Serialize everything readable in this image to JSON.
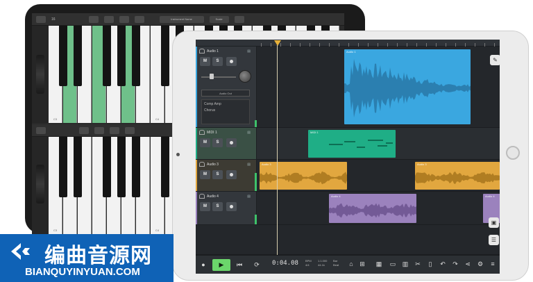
{
  "back_ipad": {
    "toolbar": {
      "left_label": "16",
      "octave_label": "C3",
      "preset_label": "Instrument Name",
      "mode_label": "Scale"
    },
    "keyboard_labels": [
      "C3",
      "C4",
      "C5"
    ]
  },
  "daw": {
    "tracks": [
      {
        "name": "Audio 1",
        "buttons": {
          "mute": "M",
          "solo": "S"
        },
        "dropdown": "Audio Out",
        "effects": [
          "Comp Amp",
          "Chorus"
        ],
        "color": "#3aa7e0"
      },
      {
        "name": "MIDI 1",
        "buttons": {
          "mute": "M",
          "solo": "S"
        },
        "color": "#1fae86"
      },
      {
        "name": "Audio 3",
        "buttons": {
          "mute": "M",
          "solo": "S"
        },
        "color": "#e2a73f"
      },
      {
        "name": "Audio 4",
        "buttons": {
          "mute": "M",
          "solo": "S"
        },
        "color": "#9b82bd"
      }
    ],
    "clips": [
      {
        "track": 0,
        "label": "Audio 1",
        "color": "#3aa7e0"
      },
      {
        "track": 1,
        "label": "MIDI 1",
        "color": "#1fae86"
      },
      {
        "track": 2,
        "label": "Audio 3",
        "color": "#e2a73f"
      },
      {
        "track": 2,
        "label": "Audio 3",
        "color": "#e2a73f"
      },
      {
        "track": 3,
        "label": "Audio 4",
        "color": "#9b82bd"
      },
      {
        "track": 3,
        "label": "Audio 4",
        "color": "#9b82bd"
      }
    ],
    "transport": {
      "time": "0:04.08",
      "info": [
        {
          "top": "BPM",
          "bottom": "4/4"
        },
        {
          "top": "1.1.000",
          "bottom": "44.1k"
        },
        {
          "top": "Bar",
          "bottom": "Beat"
        }
      ]
    }
  },
  "watermark": {
    "chinese": "编曲音源网",
    "english": "BIANQUYINYUAN.COM"
  }
}
